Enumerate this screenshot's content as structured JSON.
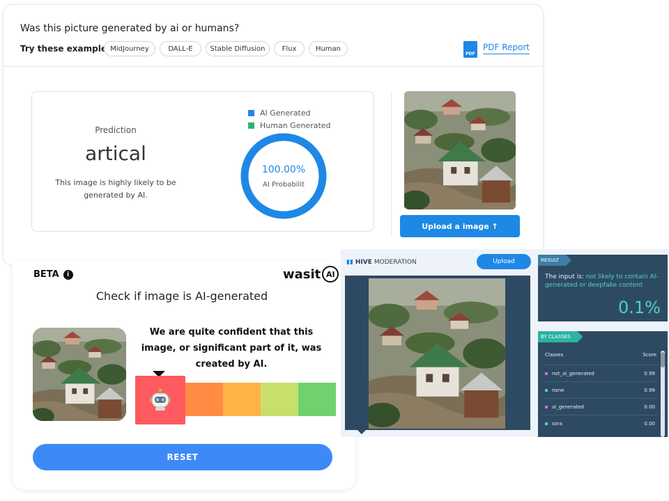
{
  "top": {
    "question": "Was this picture generated by ai or humans?",
    "try_label": "Try these examples:",
    "examples": [
      "MidJourney",
      "DALL-E",
      "Stable Diffusion",
      "Flux",
      "Human"
    ],
    "pdf_icon_text": "PDF",
    "pdf_link": "PDF Report",
    "prediction_label": "Prediction",
    "prediction_value": "artical",
    "prediction_desc": "This image is highly likely to be generated by AI.",
    "legend": [
      {
        "label": "AI Generated",
        "color": "#1e88e5"
      },
      {
        "label": "Human Generated",
        "color": "#2bb673"
      }
    ],
    "donut_percent": "100.00%",
    "donut_fraction": 1.0,
    "donut_label": "AI Probabilit",
    "upload_button": "Upload a image ↑"
  },
  "wasit": {
    "beta": "BETA",
    "info_icon": "i",
    "logo_text": "wasit",
    "logo_badge": "AI",
    "title": "Check if image is AI-generated",
    "message": "We are quite confident that this image, or significant part of it, was created by AI.",
    "scale_colors": [
      "#ff5a5f",
      "#ff8c42",
      "#ffb347",
      "#c8e06a",
      "#6fd26f"
    ],
    "scale_level": 1,
    "reset_button": "RESET"
  },
  "hive": {
    "logo_brand": "HIVE",
    "logo_suffix": "MODERATION",
    "upload_button": "Upload",
    "result_tag": "RESULT",
    "result_prefix": "The input is: ",
    "result_highlight": "not likely to contain AI-generated or deepfake content",
    "result_percent": "0.1%",
    "classes_tag": "BY CLASSES",
    "classes_col": "Classes",
    "score_col": "Score",
    "classes": [
      {
        "name": "not_ai_generated",
        "score": "0.99",
        "color": "#d16ee0"
      },
      {
        "name": "none",
        "score": "0.99",
        "color": "#4fd1c5"
      },
      {
        "name": "ai_generated",
        "score": "0.00",
        "color": "#d16ee0"
      },
      {
        "name": "sora",
        "score": "0.00",
        "color": "#4fd1c5"
      }
    ]
  }
}
